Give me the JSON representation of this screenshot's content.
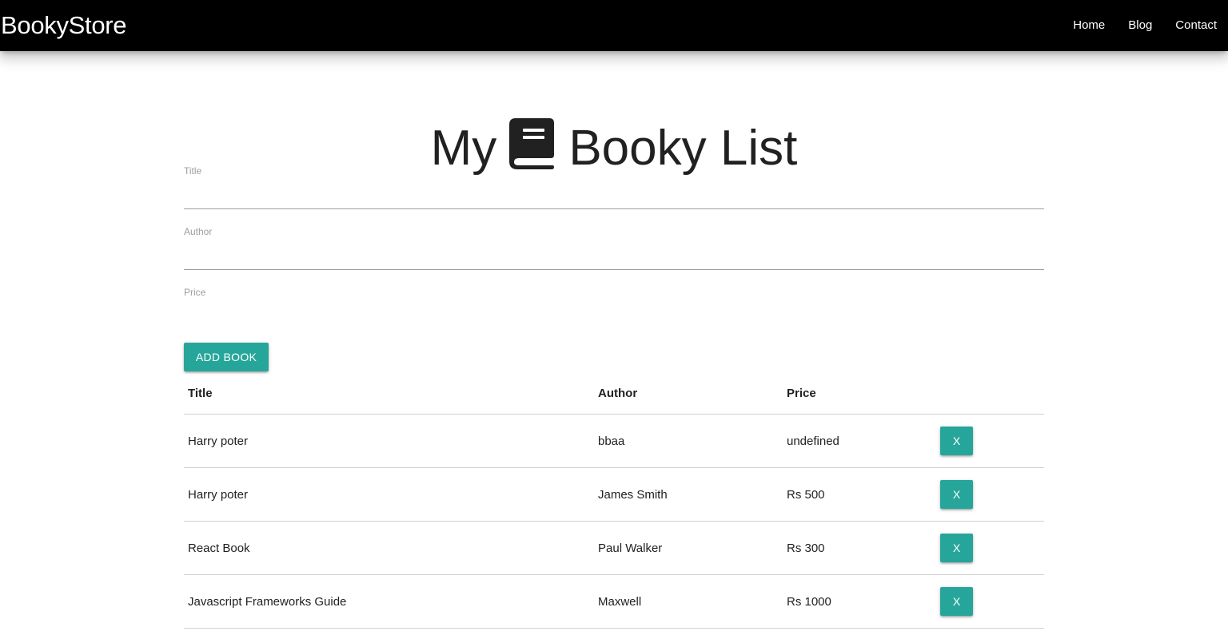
{
  "navbar": {
    "brand": "BookyStore",
    "links": [
      {
        "label": "Home"
      },
      {
        "label": "Blog"
      },
      {
        "label": "Contact"
      }
    ]
  },
  "header": {
    "title_before": "My",
    "title_after": "Booky List",
    "icon": "book-icon"
  },
  "form": {
    "title": {
      "label": "Title",
      "value": ""
    },
    "author": {
      "label": "Author",
      "value": ""
    },
    "price": {
      "label": "Price",
      "value": ""
    },
    "submit_label": "ADD BOOK"
  },
  "table": {
    "headers": [
      "Title",
      "Author",
      "Price"
    ],
    "delete_label": "X",
    "rows": [
      {
        "title": "Harry poter",
        "author": "bbaa",
        "price": "undefined"
      },
      {
        "title": "Harry poter",
        "author": "James Smith",
        "price": "Rs 500"
      },
      {
        "title": "React Book",
        "author": "Paul Walker",
        "price": "Rs 300"
      },
      {
        "title": "Javascript Frameworks Guide",
        "author": "Maxwell",
        "price": "Rs 1000"
      }
    ]
  },
  "colors": {
    "navbar": "#000000",
    "accent": "#26a69a"
  }
}
